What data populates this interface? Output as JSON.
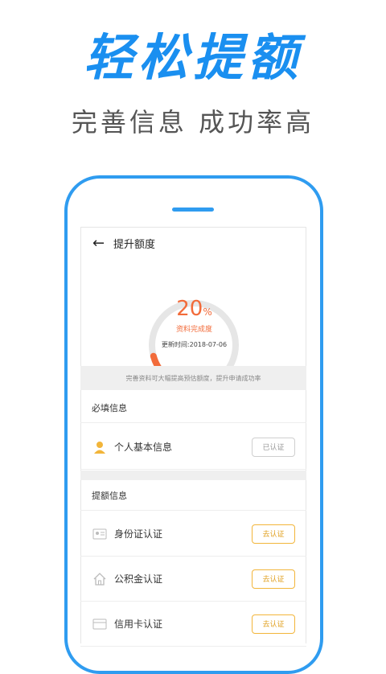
{
  "hero": {
    "title": "轻松提额",
    "subtitle": "完善信息 成功率高"
  },
  "nav": {
    "back_icon": "←",
    "title": "提升额度"
  },
  "progress": {
    "percent": 20,
    "number": "20",
    "unit": "%",
    "label": "资料完成度",
    "updated": "更新时间:2018-07-06",
    "track_color": "#e6e6e6",
    "fill_color": "#f26b3a"
  },
  "tip": "完善资料可大幅提高预估额度，提升申请成功率",
  "required": {
    "title": "必填信息",
    "items": [
      {
        "label": "个人基本信息",
        "button": "已认证",
        "icon": "person-icon"
      }
    ]
  },
  "quota": {
    "title": "提额信息",
    "items": [
      {
        "label": "身份证认证",
        "button": "去认证",
        "icon": "id-card-icon"
      },
      {
        "label": "公积金认证",
        "button": "去认证",
        "icon": "house-icon"
      },
      {
        "label": "信用卡认证",
        "button": "去认证",
        "icon": "credit-card-icon"
      }
    ]
  },
  "colors": {
    "accent": "#1a8ff0",
    "orange": "#f26b3a",
    "gold": "#f2b53a"
  }
}
